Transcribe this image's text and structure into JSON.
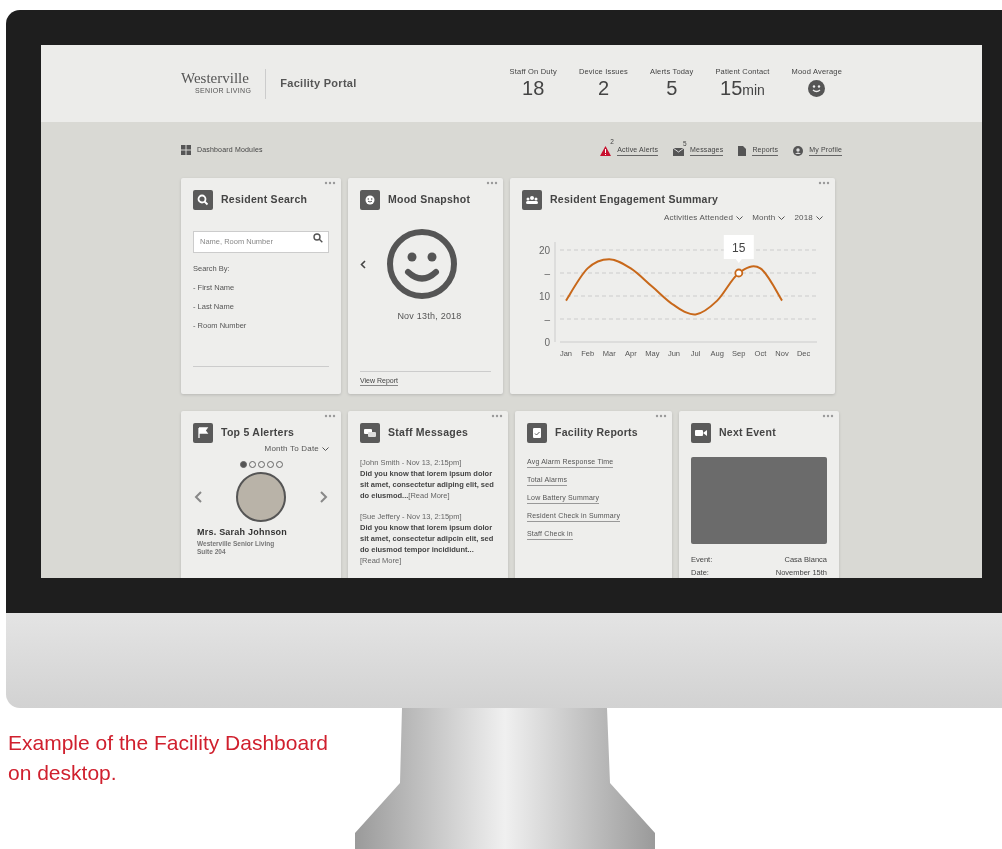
{
  "header": {
    "logo_name": "Westerville",
    "logo_sub": "SENIOR LIVING",
    "portal_title": "Facility Portal",
    "stats": [
      {
        "label": "Staff On Duty",
        "kind": "number",
        "value": "18"
      },
      {
        "label": "Device Issues",
        "kind": "number",
        "value": "2"
      },
      {
        "label": "Alerts Today",
        "kind": "number",
        "value": "5"
      },
      {
        "label": "Patient Contact",
        "kind": "number",
        "value": "15",
        "unit": "min"
      },
      {
        "label": "Mood Average",
        "kind": "mood"
      }
    ]
  },
  "toolbar": {
    "modules_label": "Dashboard Modules",
    "links": [
      {
        "label": "Active Alerts",
        "badge": "2",
        "kind": "alert"
      },
      {
        "label": "Messages",
        "badge": "5",
        "kind": "mail"
      },
      {
        "label": "Reports",
        "kind": "document"
      },
      {
        "label": "My Profile",
        "kind": "profile"
      }
    ]
  },
  "resident_search": {
    "title": "Resident Search",
    "placeholder": "Name, Room Number",
    "search_by_label": "Search By:",
    "options": [
      "- First Name",
      "- Last Name",
      "- Room Number"
    ]
  },
  "mood_snapshot": {
    "title": "Mood Snapshot",
    "date": "Nov 13th, 2018",
    "link": "View Report"
  },
  "engagement": {
    "title": "Resident Engagement Summary",
    "filters": [
      "Activities Attended",
      "Month",
      "2018"
    ],
    "chart_data": {
      "type": "line",
      "categories": [
        "Jan",
        "Feb",
        "Mar",
        "Apr",
        "May",
        "Jun",
        "Jul",
        "Aug",
        "Sep",
        "Oct",
        "Nov",
        "Dec"
      ],
      "grid": true,
      "series": [
        {
          "color": "#c8681a",
          "values": [
            9,
            16,
            18,
            16,
            12,
            8,
            6,
            9,
            15,
            16,
            9,
            null
          ]
        }
      ],
      "ylim": [
        0,
        20
      ],
      "yticks": [
        0,
        {
          "value": 5,
          "label": "–"
        },
        10,
        {
          "value": 15,
          "label": "–"
        },
        20
      ],
      "annotations": [
        {
          "x": "Sep",
          "y": 15,
          "text": "15"
        }
      ]
    }
  },
  "top_alerters": {
    "title": "Top 5 Alerters",
    "period": "Month To Date",
    "pager": [
      {
        "selected": true
      },
      {
        "selected": false
      },
      {
        "selected": false
      },
      {
        "selected": false
      },
      {
        "selected": false
      }
    ],
    "name": "Mrs. Sarah Johnson",
    "facility": "Westerville Senior Living",
    "suite": "Suite 204"
  },
  "staff_messages": {
    "title": "Staff Messages",
    "messages": [
      {
        "header": "[John Smith - Nov 13, 2:15pm]",
        "body": "Did you know that lorem ipsum dolor sit amet, consectetur adiping elit, sed do eiusmod...",
        "more": "[Read More]"
      },
      {
        "header": "[Sue Jeffery - Nov 13, 2:15pm]",
        "body": "Did you know that lorem ipsum dolor sit amet, consectetur adipcin elit, sed do eiusmod tempor incididunt...",
        "more": "[Read More]"
      }
    ]
  },
  "facility_reports": {
    "title": "Facility Reports",
    "links": [
      "Avg Alarm Response Time",
      "Total Alarms",
      "Low Battery Summary",
      "Resident Check in Summary",
      "Staff Check in"
    ]
  },
  "next_event": {
    "title": "Next Event",
    "details": [
      {
        "label": "Event:",
        "value": "Casa Blanca"
      },
      {
        "label": "Date:",
        "value": "November 15th"
      }
    ]
  },
  "caption": "Example of the Facility Dashboard on desktop."
}
